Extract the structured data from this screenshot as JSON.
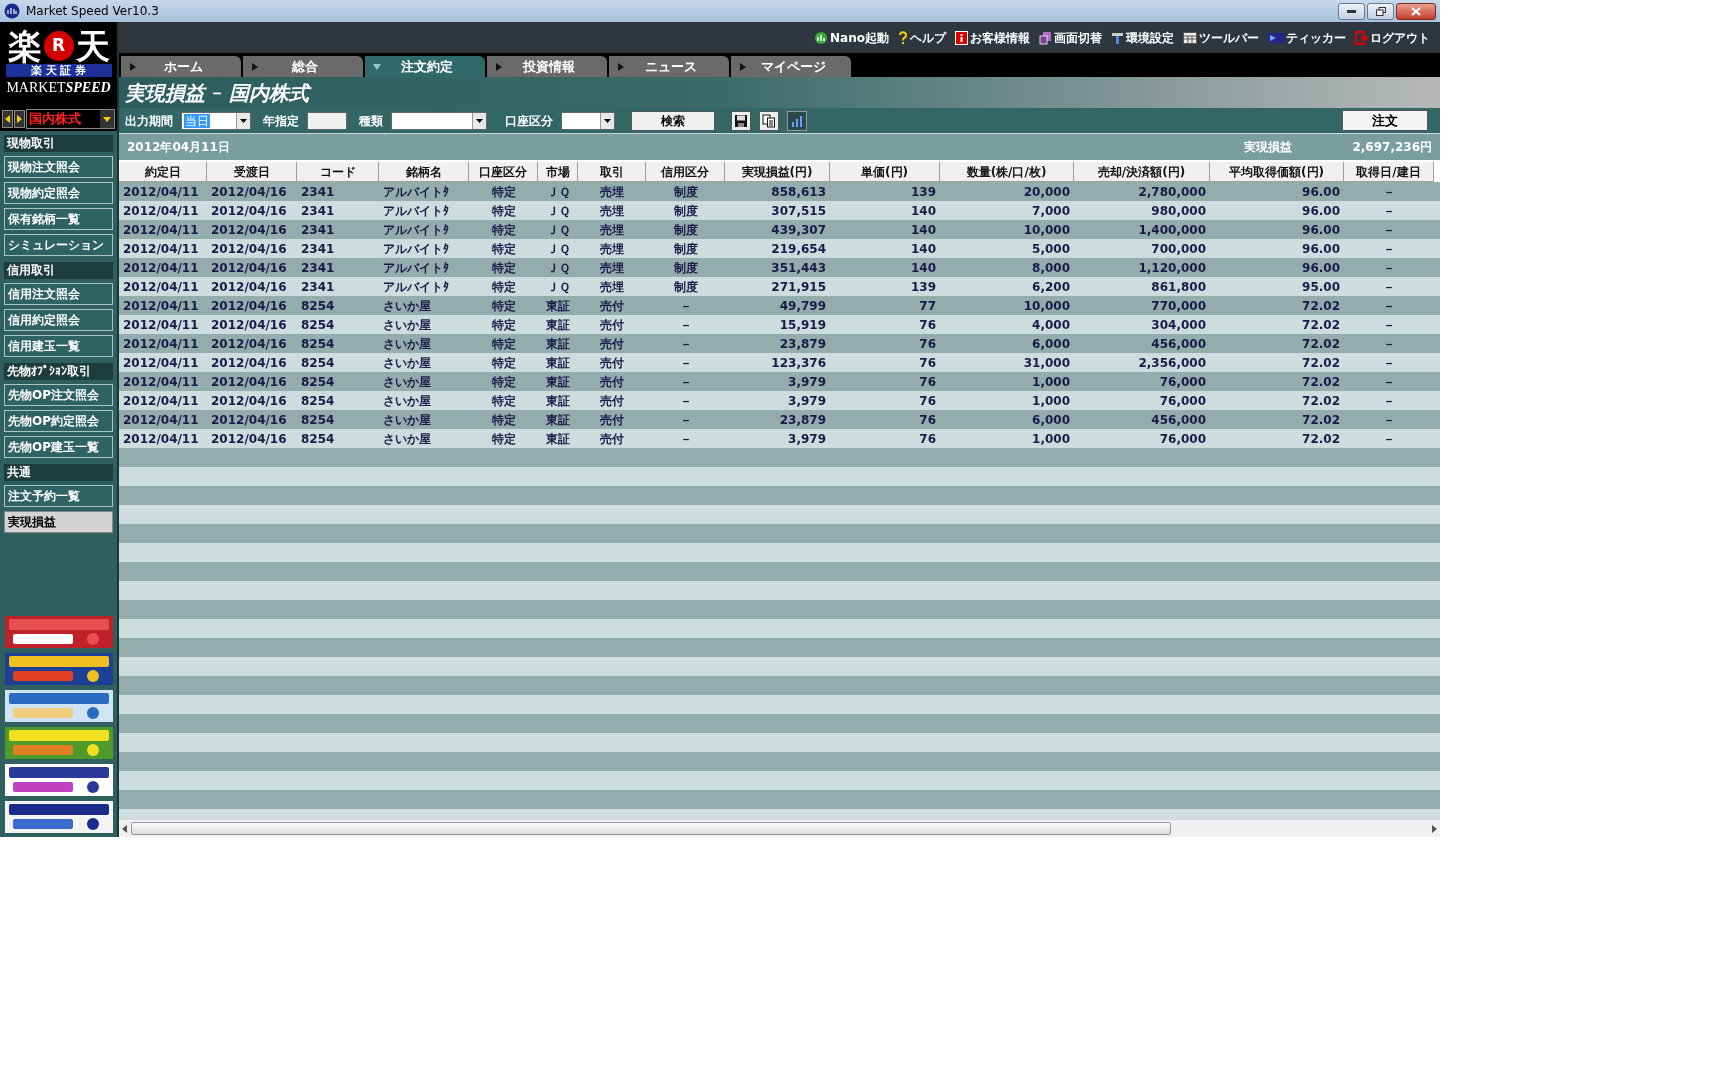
{
  "window": {
    "title": "Market Speed Ver10.3"
  },
  "toolbar": [
    {
      "label": "Nano起動",
      "kind": "nano"
    },
    {
      "label": "ヘルプ",
      "kind": "help"
    },
    {
      "label": "お客様情報",
      "kind": "info"
    },
    {
      "label": "画面切替",
      "kind": "switch"
    },
    {
      "label": "環境設定",
      "kind": "settings"
    },
    {
      "label": "ツールバー",
      "kind": "toolbar"
    },
    {
      "label": "ティッカー",
      "kind": "ticker"
    },
    {
      "label": "ログアウト",
      "kind": "logout"
    }
  ],
  "logo": {
    "left": "楽",
    "mark": "R",
    "right": "天",
    "sub": "楽 天 証 券",
    "product_a": "MARKET",
    "product_b": "SPEED"
  },
  "tabs": [
    {
      "label": "ホーム",
      "selected": false
    },
    {
      "label": "総合",
      "selected": false
    },
    {
      "label": "注文約定",
      "selected": true
    },
    {
      "label": "投資情報",
      "selected": false
    },
    {
      "label": "ニュース",
      "selected": false
    },
    {
      "label": "マイページ",
      "selected": false
    }
  ],
  "market_selector": {
    "value": "国内株式"
  },
  "sidebar": [
    {
      "title": "現物取引",
      "items": [
        {
          "label": "現物注文照会",
          "selected": false
        },
        {
          "label": "現物約定照会",
          "selected": false
        },
        {
          "label": "保有銘柄一覧",
          "selected": false
        },
        {
          "label": "シミュレーション",
          "selected": false
        }
      ]
    },
    {
      "title": "信用取引",
      "items": [
        {
          "label": "信用注文照会",
          "selected": false
        },
        {
          "label": "信用約定照会",
          "selected": false
        },
        {
          "label": "信用建玉一覧",
          "selected": false
        }
      ]
    },
    {
      "title": "先物ｵﾌﾟｼｮﾝ取引",
      "items": [
        {
          "label": "先物OP注文照会",
          "selected": false
        },
        {
          "label": "先物OP約定照会",
          "selected": false
        },
        {
          "label": "先物OP建玉一覧",
          "selected": false
        }
      ]
    },
    {
      "title": "共通",
      "items": [
        {
          "label": "注文予約一覧",
          "selected": false
        },
        {
          "label": "実現損益",
          "selected": true
        }
      ]
    }
  ],
  "page_header": {
    "title": "実現損益",
    "separator": "－",
    "subtitle": "国内株式"
  },
  "filters": {
    "period_label": "出力期間",
    "period_value": "当日",
    "year_label": "年指定",
    "type_label": "種類",
    "account_label": "口座区分",
    "search_button": "検索",
    "order_button": "注文"
  },
  "summary": {
    "date": "2012年04月11日",
    "label": "実現損益",
    "value": "2,697,236円"
  },
  "table": {
    "columns": [
      "約定日",
      "受渡日",
      "コード",
      "銘柄名",
      "口座区分",
      "市場",
      "取引",
      "信用区分",
      "実現損益(円)",
      "単価(円)",
      "数量(株/口/枚)",
      "売却/決済額(円)",
      "平均取得価額(円)",
      "取得日/建日"
    ],
    "rows": [
      [
        "2012/04/11",
        "2012/04/16",
        "2341",
        "アルバイトﾀ",
        "特定",
        "ＪＱ",
        "売埋",
        "制度",
        "858,613",
        "139",
        "20,000",
        "2,780,000",
        "96.00",
        "－"
      ],
      [
        "2012/04/11",
        "2012/04/16",
        "2341",
        "アルバイトﾀ",
        "特定",
        "ＪＱ",
        "売埋",
        "制度",
        "307,515",
        "140",
        "7,000",
        "980,000",
        "96.00",
        "－"
      ],
      [
        "2012/04/11",
        "2012/04/16",
        "2341",
        "アルバイトﾀ",
        "特定",
        "ＪＱ",
        "売埋",
        "制度",
        "439,307",
        "140",
        "10,000",
        "1,400,000",
        "96.00",
        "－"
      ],
      [
        "2012/04/11",
        "2012/04/16",
        "2341",
        "アルバイトﾀ",
        "特定",
        "ＪＱ",
        "売埋",
        "制度",
        "219,654",
        "140",
        "5,000",
        "700,000",
        "96.00",
        "－"
      ],
      [
        "2012/04/11",
        "2012/04/16",
        "2341",
        "アルバイトﾀ",
        "特定",
        "ＪＱ",
        "売埋",
        "制度",
        "351,443",
        "140",
        "8,000",
        "1,120,000",
        "96.00",
        "－"
      ],
      [
        "2012/04/11",
        "2012/04/16",
        "2341",
        "アルバイトﾀ",
        "特定",
        "ＪＱ",
        "売埋",
        "制度",
        "271,915",
        "139",
        "6,200",
        "861,800",
        "95.00",
        "－"
      ],
      [
        "2012/04/11",
        "2012/04/16",
        "8254",
        "さいか屋",
        "特定",
        "東証",
        "売付",
        "－",
        "49,799",
        "77",
        "10,000",
        "770,000",
        "72.02",
        "－"
      ],
      [
        "2012/04/11",
        "2012/04/16",
        "8254",
        "さいか屋",
        "特定",
        "東証",
        "売付",
        "－",
        "15,919",
        "76",
        "4,000",
        "304,000",
        "72.02",
        "－"
      ],
      [
        "2012/04/11",
        "2012/04/16",
        "8254",
        "さいか屋",
        "特定",
        "東証",
        "売付",
        "－",
        "23,879",
        "76",
        "6,000",
        "456,000",
        "72.02",
        "－"
      ],
      [
        "2012/04/11",
        "2012/04/16",
        "8254",
        "さいか屋",
        "特定",
        "東証",
        "売付",
        "－",
        "123,376",
        "76",
        "31,000",
        "2,356,000",
        "72.02",
        "－"
      ],
      [
        "2012/04/11",
        "2012/04/16",
        "8254",
        "さいか屋",
        "特定",
        "東証",
        "売付",
        "－",
        "3,979",
        "76",
        "1,000",
        "76,000",
        "72.02",
        "－"
      ],
      [
        "2012/04/11",
        "2012/04/16",
        "8254",
        "さいか屋",
        "特定",
        "東証",
        "売付",
        "－",
        "3,979",
        "76",
        "1,000",
        "76,000",
        "72.02",
        "－"
      ],
      [
        "2012/04/11",
        "2012/04/16",
        "8254",
        "さいか屋",
        "特定",
        "東証",
        "売付",
        "－",
        "23,879",
        "76",
        "6,000",
        "456,000",
        "72.02",
        "－"
      ],
      [
        "2012/04/11",
        "2012/04/16",
        "8254",
        "さいか屋",
        "特定",
        "東証",
        "売付",
        "－",
        "3,979",
        "76",
        "1,000",
        "76,000",
        "72.02",
        "－"
      ]
    ]
  }
}
